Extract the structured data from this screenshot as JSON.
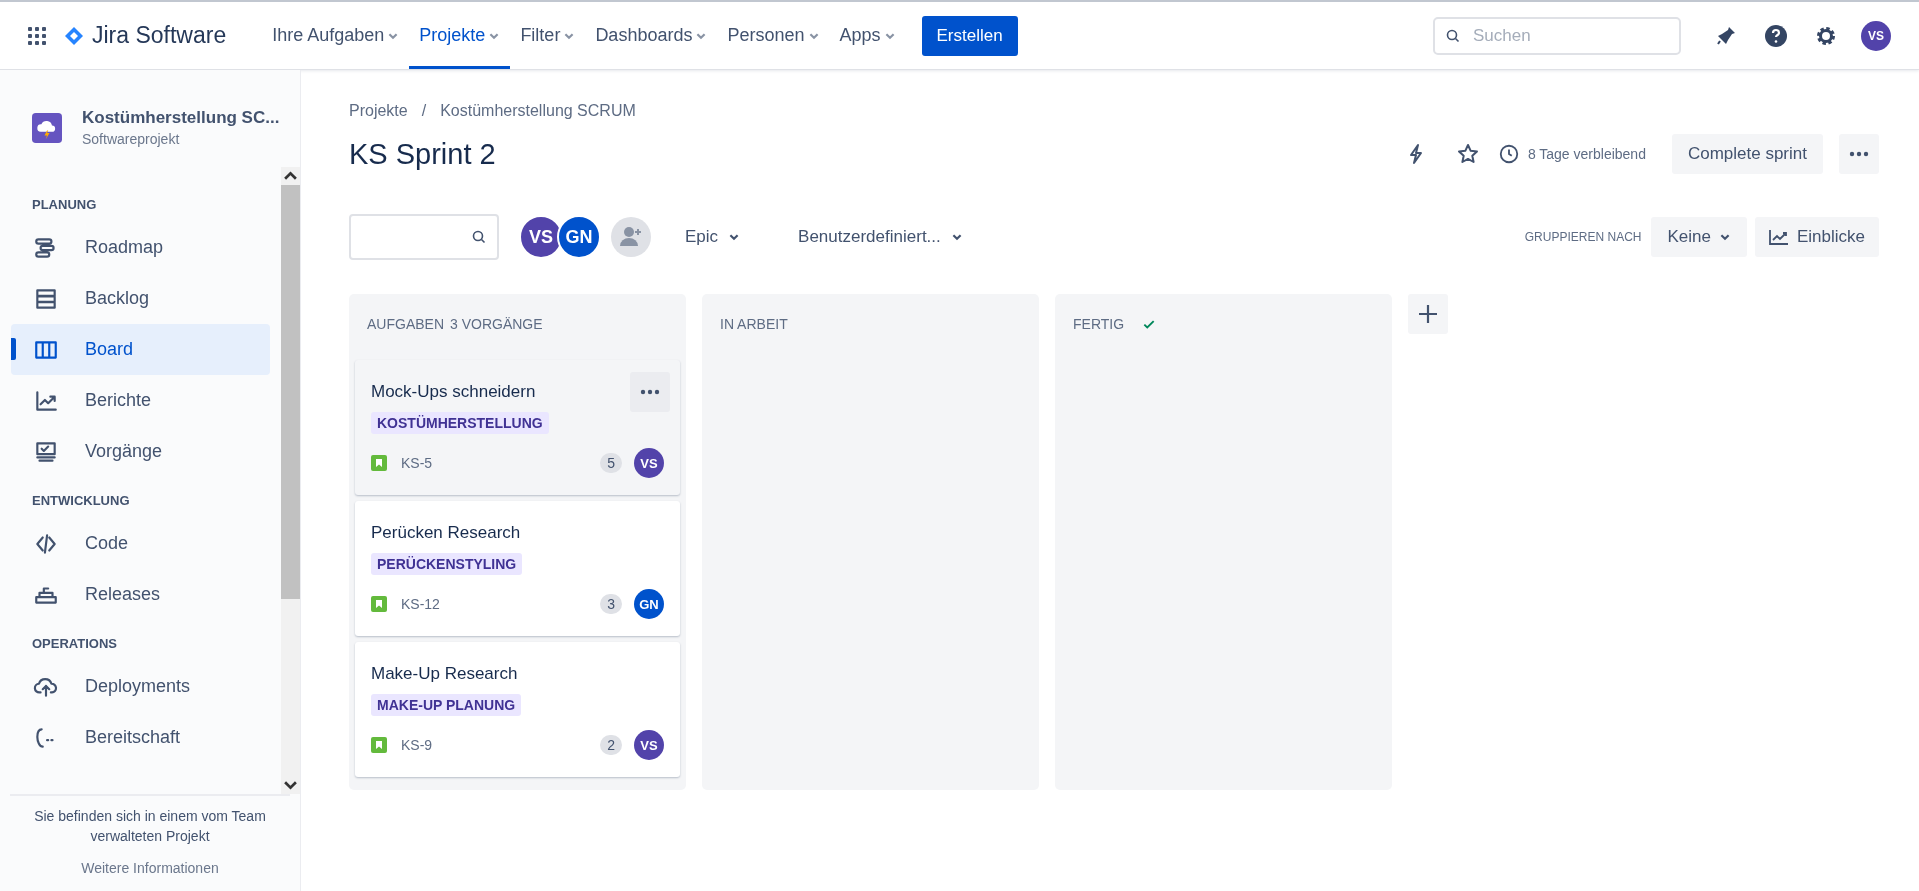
{
  "topbar": {
    "product": "Jira Software",
    "nav": [
      {
        "label": "Ihre Aufgaben",
        "selected": false
      },
      {
        "label": "Projekte",
        "selected": true
      },
      {
        "label": "Filter",
        "selected": false
      },
      {
        "label": "Dashboards",
        "selected": false
      },
      {
        "label": "Personen",
        "selected": false
      },
      {
        "label": "Apps",
        "selected": false
      }
    ],
    "create": "Erstellen",
    "search": {
      "placeholder": "Suchen"
    },
    "avatar": "VS"
  },
  "sidebar": {
    "project": "Kostümherstellung SC...",
    "project_type": "Softwareprojekt",
    "sections": [
      {
        "title": "PLANUNG",
        "items": [
          {
            "label": "Roadmap",
            "selected": false
          },
          {
            "label": "Backlog",
            "selected": false
          },
          {
            "label": "Board",
            "selected": true
          },
          {
            "label": "Berichte",
            "selected": false
          },
          {
            "label": "Vorgänge",
            "selected": false
          }
        ]
      },
      {
        "title": "ENTWICKLUNG",
        "items": [
          {
            "label": "Code",
            "selected": false
          },
          {
            "label": "Releases",
            "selected": false
          }
        ]
      },
      {
        "title": "OPERATIONS",
        "items": [
          {
            "label": "Deployments",
            "selected": false
          },
          {
            "label": "Bereitschaft",
            "selected": false
          }
        ]
      }
    ],
    "footer": "Sie befinden sich in einem vom Team verwalteten Projekt",
    "footer_link": "Weitere Informationen"
  },
  "breadcrumbs": [
    "Projekte",
    "Kostümherstellung SCRUM"
  ],
  "breadcrumb_separator": "/",
  "title": "KS Sprint 2",
  "remaining": "8 Tage verbleibend",
  "complete": "Complete sprint",
  "filters": {
    "avatars": [
      {
        "initials": "VS",
        "color": "#5243aa"
      },
      {
        "initials": "GN",
        "color": "#0052cc"
      }
    ],
    "epic": "Epic",
    "custom": "Benutzerdefiniert...",
    "group_label": "GRUPPIEREN NACH",
    "group_value": "Keine",
    "insights": "Einblicke"
  },
  "columns": [
    {
      "title": "AUFGABEN",
      "count": "3 VORGÄNGE",
      "done": false,
      "cards": [
        {
          "title": "Mock-Ups schneidern",
          "epic": "KOSTÜMHERSTELLUNG",
          "key": "KS-5",
          "points": "5",
          "assignee": "VS",
          "color": "#5243aa",
          "hovered": true
        },
        {
          "title": "Perücken Research",
          "epic": "PERÜCKENSTYLING",
          "key": "KS-12",
          "points": "3",
          "assignee": "GN",
          "color": "#0052cc",
          "hovered": false
        },
        {
          "title": "Make-Up Research",
          "epic": "MAKE-UP PLANUNG",
          "key": "KS-9",
          "points": "2",
          "assignee": "VS",
          "color": "#5243aa",
          "hovered": false
        }
      ]
    },
    {
      "title": "IN ARBEIT",
      "done": false
    },
    {
      "title": "FERTIG",
      "done": true
    }
  ]
}
